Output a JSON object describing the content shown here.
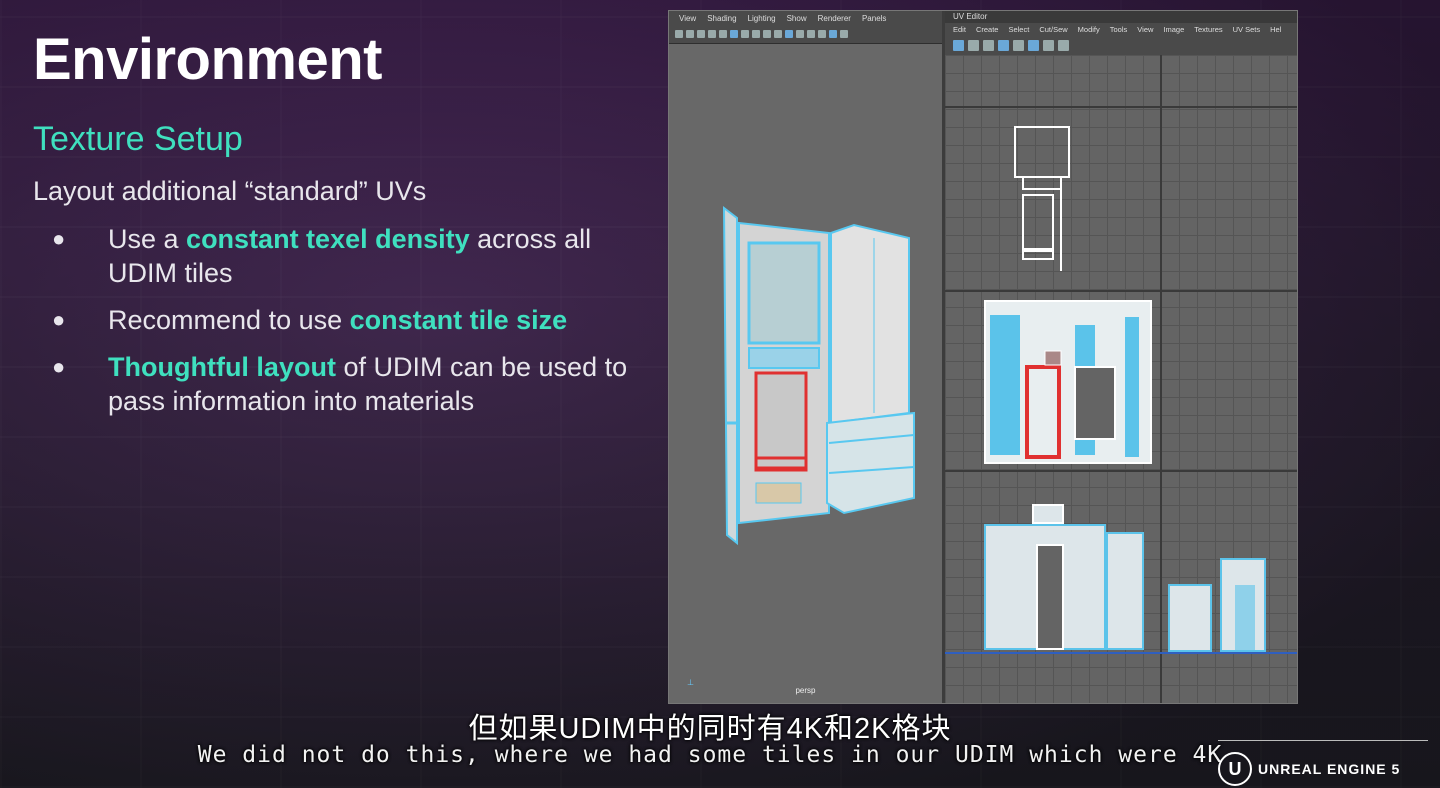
{
  "slide": {
    "title": "Environment",
    "section": "Texture Setup",
    "intro": "Layout additional “standard” UVs",
    "bullet_char": "●",
    "bullets": [
      {
        "pre": "Use a ",
        "highlight": "constant texel density",
        "post": " across all UDIM tiles"
      },
      {
        "pre": "Recommend to use ",
        "highlight": "constant tile size",
        "post": ""
      },
      {
        "pre": "",
        "highlight": "Thoughtful layout",
        "post": " of UDIM can be used to pass information into materials"
      }
    ],
    "accent_color": "#3fe0bf"
  },
  "maya": {
    "viewport_menu": [
      "View",
      "Shading",
      "Lighting",
      "Show",
      "Renderer",
      "Panels"
    ],
    "viewport_camera": "persp",
    "uv_title": "UV Editor",
    "uv_menu": [
      "Edit",
      "Create",
      "Select",
      "Cut/Sew",
      "Modify",
      "Tools",
      "View",
      "Image",
      "Textures",
      "UV Sets",
      "Hel"
    ]
  },
  "subtitles": {
    "cn": "但如果UDIM中的同时有4K和2K格块",
    "en": "We did not do this, where we had some tiles in our UDIM which were 4K"
  },
  "brand": {
    "badge": "U",
    "name": "UNREAL ENGINE 5"
  }
}
